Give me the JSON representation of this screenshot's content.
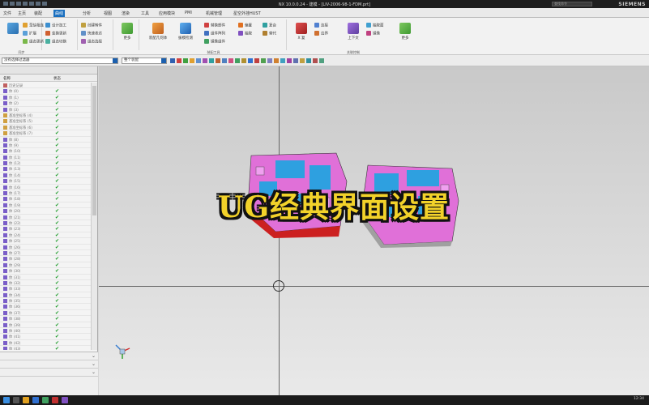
{
  "window": {
    "title": "NX 10.0.0.24 - 建模 - [LIV-2006-98-1-FDM.prt]",
    "brand": "SIEMENS",
    "search_placeholder": "查找命令"
  },
  "menu_tabs": [
    "文件",
    "主页",
    "装配",
    "曲线",
    "分析",
    "视图",
    "渲染",
    "工具",
    "应用模块",
    "PMI",
    "机械管理",
    "星空外挂HUST"
  ],
  "active_tab": "曲线",
  "ribbon": {
    "groups": [
      {
        "label": "同步",
        "items": [
          "草绘相连",
          "扩展",
          "组态更新"
        ]
      },
      {
        "label": "",
        "items": [
          "设计加工",
          "变换更新",
          "组态切换"
        ]
      },
      {
        "label": "",
        "items": [
          "创建转件",
          "快速表达",
          "组态选择"
        ]
      },
      {
        "label": "",
        "items": [
          "更多"
        ]
      },
      {
        "label": "装配工具",
        "items": [
          "装配几何体",
          "拔模检测",
          "替换部件",
          "组件阵列",
          "镜像组件",
          "偏置",
          "抽取",
          "复合",
          "替代"
        ]
      },
      {
        "label": "关联控制",
        "items": [
          "X 复",
          "连接",
          "边界",
          "上下文",
          "抽取面",
          "镜像"
        ]
      }
    ]
  },
  "toolbar2": {
    "filter_combo": "没有选择过滤器",
    "scope_combo": "整个装配"
  },
  "navigator": {
    "col_name": "名称",
    "col_status": "状态",
    "rows": [
      "历史记录",
      "体 (0)",
      "体 (1)",
      "体 (2)",
      "体 (3)",
      "基准坐标系 (4)",
      "基准坐标系 (5)",
      "基准坐标系 (6)",
      "基准坐标系 (7)",
      "体 (8)",
      "体 (9)",
      "体 (10)",
      "体 (11)",
      "体 (12)",
      "体 (13)",
      "体 (14)",
      "体 (15)",
      "体 (16)",
      "体 (17)",
      "体 (18)",
      "体 (19)",
      "体 (20)",
      "体 (21)",
      "体 (22)",
      "体 (23)",
      "体 (24)",
      "体 (25)",
      "体 (26)",
      "体 (27)",
      "体 (28)",
      "体 (29)",
      "体 (30)",
      "体 (31)",
      "体 (32)",
      "体 (33)",
      "体 (34)",
      "体 (35)",
      "体 (36)",
      "体 (37)",
      "体 (38)",
      "体 (39)",
      "体 (40)",
      "体 (41)",
      "体 (42)",
      "体 (43)"
    ],
    "sections": [
      "相依性",
      "细节",
      "预览"
    ]
  },
  "overlay_text": "UG经典界面设置",
  "colors": {
    "accent": "#1a6fbf",
    "check": "#1d9b2a",
    "overlay_fill": "#f2d22a",
    "model_pink": "#e070d8",
    "model_blue": "#2ea0e0",
    "model_red": "#cc2020"
  },
  "taskbar": {
    "clock": "12:34"
  }
}
